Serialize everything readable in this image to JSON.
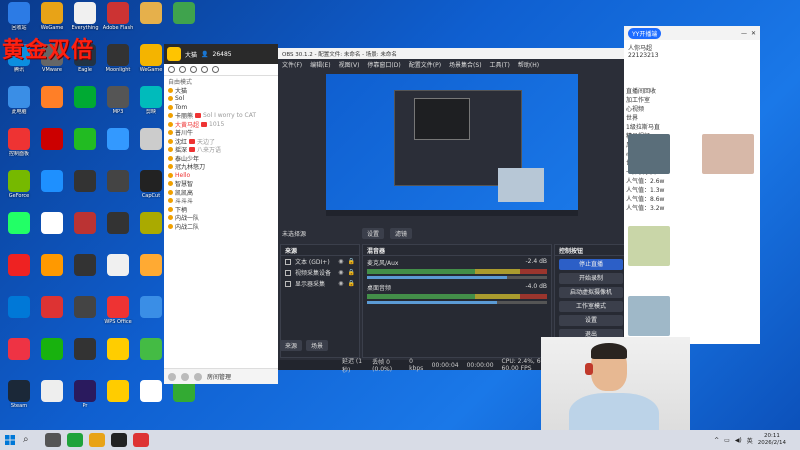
{
  "overlay_title": "黄金双倍",
  "desktop_icons": [
    {
      "label": "回收站",
      "color": "#2c7be5"
    },
    {
      "label": "WeGame",
      "color": "#e8a317"
    },
    {
      "label": "Everything",
      "color": "#f0f0f0"
    },
    {
      "label": "Adobe Flash",
      "color": "#c33"
    },
    {
      "label": "",
      "color": "#e6b04b"
    },
    {
      "label": "",
      "color": "#3fa34d"
    },
    {
      "label": "腾讯",
      "color": "#0b8fe0"
    },
    {
      "label": "VMware",
      "color": "#666"
    },
    {
      "label": "Eagle",
      "color": "#234"
    },
    {
      "label": "Moonlight",
      "color": "#333"
    },
    {
      "label": "WeGame",
      "color": "#f4b400"
    },
    {
      "label": "",
      "color": "#888"
    },
    {
      "label": "此电脑",
      "color": "#3a8ee6"
    },
    {
      "label": "",
      "color": "#ff7f27"
    },
    {
      "label": "",
      "color": "#0a3"
    },
    {
      "label": "MP3",
      "color": "#555"
    },
    {
      "label": "剪映",
      "color": "#0bb"
    },
    {
      "label": "",
      "color": "#ff6a00"
    },
    {
      "label": "控制面板",
      "color": "#e33"
    },
    {
      "label": "",
      "color": "#c00"
    },
    {
      "label": "",
      "color": "#2b2"
    },
    {
      "label": "",
      "color": "#39f"
    },
    {
      "label": "",
      "color": "#ccc"
    },
    {
      "label": "",
      "color": "#c33"
    },
    {
      "label": "GeForce",
      "color": "#76b900"
    },
    {
      "label": "",
      "color": "#1e90ff"
    },
    {
      "label": "",
      "color": "#333"
    },
    {
      "label": "",
      "color": "#444"
    },
    {
      "label": "CapCut",
      "color": "#222"
    },
    {
      "label": "",
      "color": "#0070c0"
    },
    {
      "label": "",
      "color": "#2f6"
    },
    {
      "label": "",
      "color": "#fff"
    },
    {
      "label": "",
      "color": "#b33"
    },
    {
      "label": "",
      "color": "#333"
    },
    {
      "label": "",
      "color": "#aa0"
    },
    {
      "label": "",
      "color": "#0af"
    },
    {
      "label": "",
      "color": "#e22"
    },
    {
      "label": "",
      "color": "#f90"
    },
    {
      "label": "",
      "color": "#333"
    },
    {
      "label": "",
      "color": "#f0f0f0"
    },
    {
      "label": "",
      "color": "#fa3"
    },
    {
      "label": "",
      "color": "#fc0"
    },
    {
      "label": "",
      "color": "#0078d7"
    },
    {
      "label": "",
      "color": "#d33"
    },
    {
      "label": "",
      "color": "#444"
    },
    {
      "label": "WPS Office",
      "color": "#e33"
    },
    {
      "label": "",
      "color": "#3a8ee6"
    },
    {
      "label": "",
      "color": "#222"
    },
    {
      "label": "",
      "color": "#e34"
    },
    {
      "label": "",
      "color": "#18b20e"
    },
    {
      "label": "",
      "color": "#333"
    },
    {
      "label": "",
      "color": "#ffcd00"
    },
    {
      "label": "",
      "color": "#4b4"
    },
    {
      "label": "",
      "color": "#ddd"
    },
    {
      "label": "Steam",
      "color": "#1b2838"
    },
    {
      "label": "",
      "color": "#eee"
    },
    {
      "label": "Pr",
      "color": "#2a1a5e"
    },
    {
      "label": "",
      "color": "#fc0"
    },
    {
      "label": "",
      "color": "#fff"
    },
    {
      "label": "",
      "color": "#3a3"
    }
  ],
  "yy": {
    "title": "大猫",
    "count": "26485",
    "mode": "自由模式",
    "rows": [
      {
        "name": "大猫",
        "red": false
      },
      {
        "name": "Sol",
        "red": false
      },
      {
        "name": "Tom",
        "red": false
      },
      {
        "name": "卡丽熊",
        "red": false,
        "note": "Sol I worry to CAT"
      },
      {
        "name": "大黄马超",
        "red": true,
        "note": "1015"
      },
      {
        "name": "普川牛",
        "red": false
      },
      {
        "name": "沈红",
        "red": false,
        "note": "天边了"
      },
      {
        "name": "摇深",
        "red": false,
        "note": "八来万语"
      },
      {
        "name": "泰山少年",
        "red": false
      },
      {
        "name": "冠九林怒刀",
        "red": false
      },
      {
        "name": "Hello",
        "red": true
      },
      {
        "name": "智慧智",
        "red": false
      },
      {
        "name": "凯凯高",
        "red": false
      },
      {
        "name": "斗斗斗",
        "red": false
      },
      {
        "name": "下柄",
        "red": false
      },
      {
        "name": "内战一队",
        "red": false
      },
      {
        "name": "内战二队",
        "red": false
      }
    ],
    "bottom_label": "房间管理"
  },
  "obs": {
    "window_title": "OBS 30.1.2 - 配置文件: 未命名 - 场景: 未命名",
    "menu": [
      "文件(F)",
      "编辑(E)",
      "视图(V)",
      "停靠窗口(D)",
      "配置文件(P)",
      "场景集合(S)",
      "工具(T)",
      "帮助(H)"
    ],
    "scene_label": "未选择源",
    "settings_btn": "设置",
    "filters_btn": "滤镜",
    "sources_title": "来源",
    "sources": [
      "文本 (GDI+)",
      "视频采集设备",
      "显示器采集"
    ],
    "mixer_title": "混音器",
    "tracks": [
      {
        "name": "麦克风/Aux",
        "db": "-2.4 dB",
        "level": 0.78
      },
      {
        "name": "桌面音频",
        "db": "-4.0 dB",
        "level": 0.72
      }
    ],
    "controls_title": "控制按钮",
    "controls": [
      "停止直播",
      "开始录制",
      "启动虚拟摄像机",
      "工作室模式",
      "设置",
      "退出"
    ],
    "tab_sources": "来源",
    "tab_scenes": "场景",
    "status": [
      "延迟 (1 秒)",
      "丢帧 0 (0.0%)",
      "0 kbps",
      "00:00:04",
      "00:00:00",
      "CPU: 2.4%, 60.00 / 60.00 FPS"
    ]
  },
  "browser": {
    "pill": "YY开播端",
    "user": "人你马超",
    "id": "22123213",
    "texts": [
      "直播间回收",
      "加工作室",
      "心视频",
      "世界",
      "1级拉斯马直",
      "精品视频",
      "风景",
      "心一搜",
      "世兰-群",
      "一探快乐女",
      "人气值：2.6w",
      "人气值：1.3w",
      "人气值：8.6w",
      "人气值：3.2w"
    ]
  },
  "taskbar": {
    "time": "20:11",
    "date": "2026/2/14",
    "lang": "英"
  }
}
